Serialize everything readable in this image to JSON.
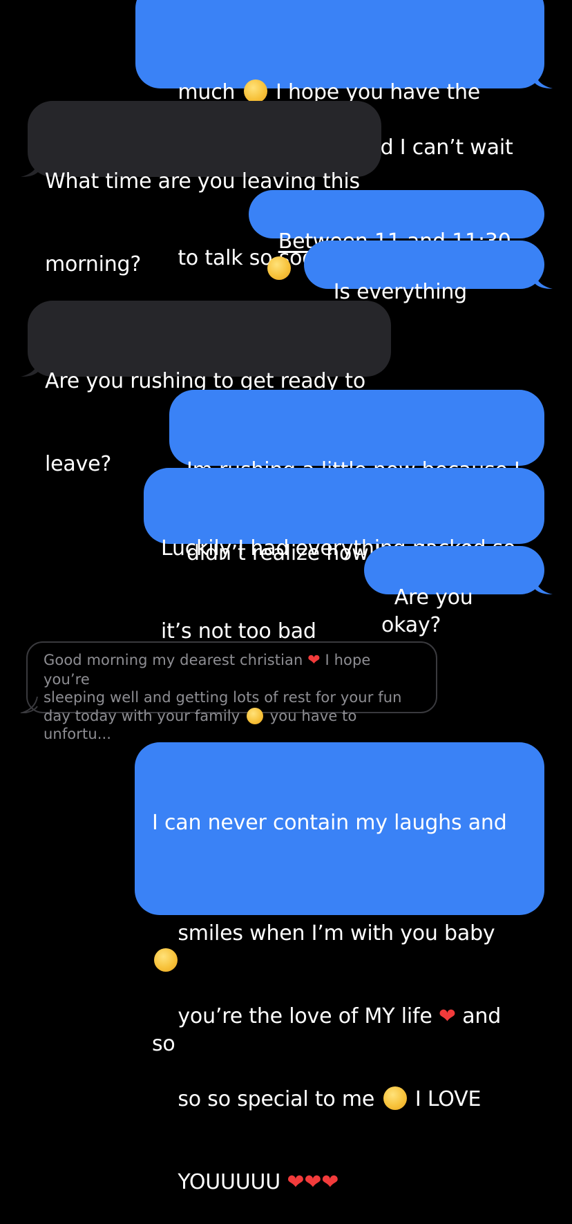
{
  "messages": [
    {
      "id": "m1",
      "side": "sent",
      "lines": [
        "much 🥺 I hope you have the most",
        "amazing day today and I can’t wait",
        "to talk so soon ❤️❤️❤️"
      ]
    },
    {
      "id": "m2",
      "side": "received",
      "lines": [
        "What time are you leaving this",
        "morning?"
      ]
    },
    {
      "id": "m3",
      "side": "sent",
      "link_text": "Between 11 and 11:30",
      "emoji": "😁"
    },
    {
      "id": "m4",
      "side": "sent",
      "lines": [
        "Is everything okay?"
      ]
    },
    {
      "id": "m5",
      "side": "received",
      "lines": [
        "Are you rushing to get ready to",
        "leave?"
      ]
    },
    {
      "id": "m6",
      "side": "sent",
      "lines": [
        "Im rushing a little now because I",
        "didn’t realize how late it got"
      ]
    },
    {
      "id": "m7",
      "side": "sent",
      "lines": [
        "Luckily I had everything packed so",
        "it’s not too bad"
      ]
    },
    {
      "id": "m8",
      "side": "sent",
      "lines": [
        "Are you okay?"
      ]
    },
    {
      "id": "m9",
      "side": "reply_preview",
      "lines": [
        "Good morning my dearest christian ❤️ I hope you’re",
        "sleeping well and getting lots of rest for your fun",
        "day today with your family 😊 you have to unfortu..."
      ]
    },
    {
      "id": "m10",
      "side": "sent",
      "lines": [
        "I can never contain my laughs and",
        "smiles when I’m with you baby 🥺",
        "you’re the love of MY life ❤️ and so",
        "so so special to me 🥰 I LOVE",
        "YOUUUUU ❤️❤️❤️"
      ]
    }
  ],
  "colors": {
    "sent_bubble": "#3a82f6",
    "received_bubble": "#26262a",
    "background": "#000000",
    "reply_text": "#8e8e93",
    "heart": "#f23b3b"
  }
}
